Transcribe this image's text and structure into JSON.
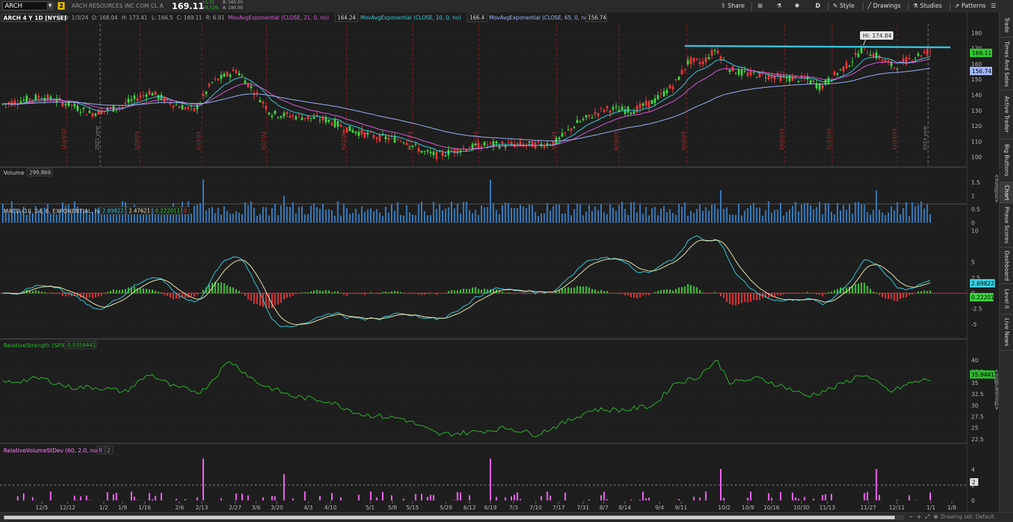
{
  "header": {
    "symbol": "ARCH",
    "link_badge": "2",
    "company": "ARCH RESOURCES INC COM CL A",
    "last": "169.11",
    "change": "+1.31",
    "change_pct": "+0.72%",
    "bid": "B: 165.50",
    "ask": "A: 190.00"
  },
  "toolbar": {
    "share": "Share",
    "period": "D",
    "style": "Style",
    "drawings": "Drawings",
    "studies": "Studies",
    "patterns": "Patterns"
  },
  "right_tabs": [
    "Trade",
    "Times And Sales",
    "Active Trader",
    "Big Buttons",
    "Chart",
    "Phase Scores",
    "Dashboard",
    "Level II",
    "Live News"
  ],
  "price_panel": {
    "title": "ARCH 4 Y 1D [NYSE]",
    "ohlc": {
      "d": "D: 1/3/24",
      "o": "O: 168.04",
      "h": "H: 173.41",
      "l": "L: 166.5",
      "c": "C: 169.11",
      "r": "R: 6.91"
    },
    "studies": [
      {
        "label": "MovAvgExponential (CLOSE, 21, 0, no)",
        "value": "164.24",
        "color": "#e05ee0"
      },
      {
        "label": "MovAvgExponential (CLOSE, 10, 0, no)",
        "value": "166.4",
        "color": "#35d0e0"
      },
      {
        "label": "MovAvgExponential (CLOSE, 65, 0, no)",
        "value": "156.74",
        "color": "#a0b8ff"
      }
    ],
    "hi_label": "Hi: 174.84",
    "last_tag": "169.11",
    "ema65_tag": "156.74",
    "axis_ticks": [
      "180",
      "170",
      "160",
      "150",
      "140",
      "130",
      "120",
      "110",
      "100"
    ],
    "vertical_labels": [
      "12/19/22",
      "2022 year",
      "1/20/23",
      "2/17/23",
      "3/17/23",
      "4/21/23",
      "5/19/23",
      "6/16/23",
      "7/21/23",
      "8/18/23",
      "9/15/23",
      "10/20/23",
      "11/17/23",
      "12/15/23",
      "2023 year"
    ]
  },
  "volume_panel": {
    "label": "Volume",
    "value": "299,869",
    "axis_ticks": [
      "1.5",
      "1",
      "0.5",
      "0"
    ],
    "unit": "<millions>"
  },
  "macd_panel": {
    "label": "MACD (10, 24, 6, EXPONENTIAL, no)",
    "v1": "2.69822",
    "v2": "2.47621",
    "v3": "0.222011",
    "v4": "0",
    "axis_ticks": [
      "10",
      "5",
      "2.5",
      "0",
      "-2.5",
      "-5"
    ],
    "tag1": "2.69822",
    "tag2": "0.22201"
  },
  "rs_panel": {
    "label": "RelativeStrength (SPX)",
    "value": "0.0359441",
    "axis_ticks": [
      "40",
      "37.5",
      "35",
      "32.5",
      "30",
      "27.5",
      "25",
      "22.5"
    ],
    "tag": "35.9441",
    "unit": "<thousandths>"
  },
  "rv_panel": {
    "label": "RelativeVolumeStDev (60, 2.0, no)",
    "v1": "0",
    "v2": "2",
    "axis_ticks": [
      "4",
      "2",
      "0"
    ],
    "tag": "2"
  },
  "x_axis": [
    "12/5",
    "12/12",
    "1/2",
    "1/9",
    "1/16",
    "2/6",
    "2/13",
    "2/27",
    "3/6",
    "3/20",
    "4/3",
    "4/10",
    "5/1",
    "5/8",
    "5/15",
    "5/29",
    "6/12",
    "6/19",
    "7/3",
    "7/10",
    "7/17",
    "7/31",
    "8/7",
    "8/14",
    "9/4",
    "9/11",
    "10/2",
    "10/9",
    "10/16",
    "10/30",
    "11/13",
    "11/27",
    "12/11",
    "1/1",
    "1/8"
  ],
  "bottom": {
    "drawing_set": "Drawing set: Default"
  },
  "colors": {
    "up": "#3ed13e",
    "down": "#e8373a",
    "ema21": "#e05ee0",
    "ema10": "#35d0e0",
    "ema65": "#a0b8ff",
    "trendline": "#33c6e0",
    "rs": "#2bb82b",
    "rv": "#ff66ff",
    "macd": "#35d0e0",
    "signal": "#f0eab0"
  }
}
